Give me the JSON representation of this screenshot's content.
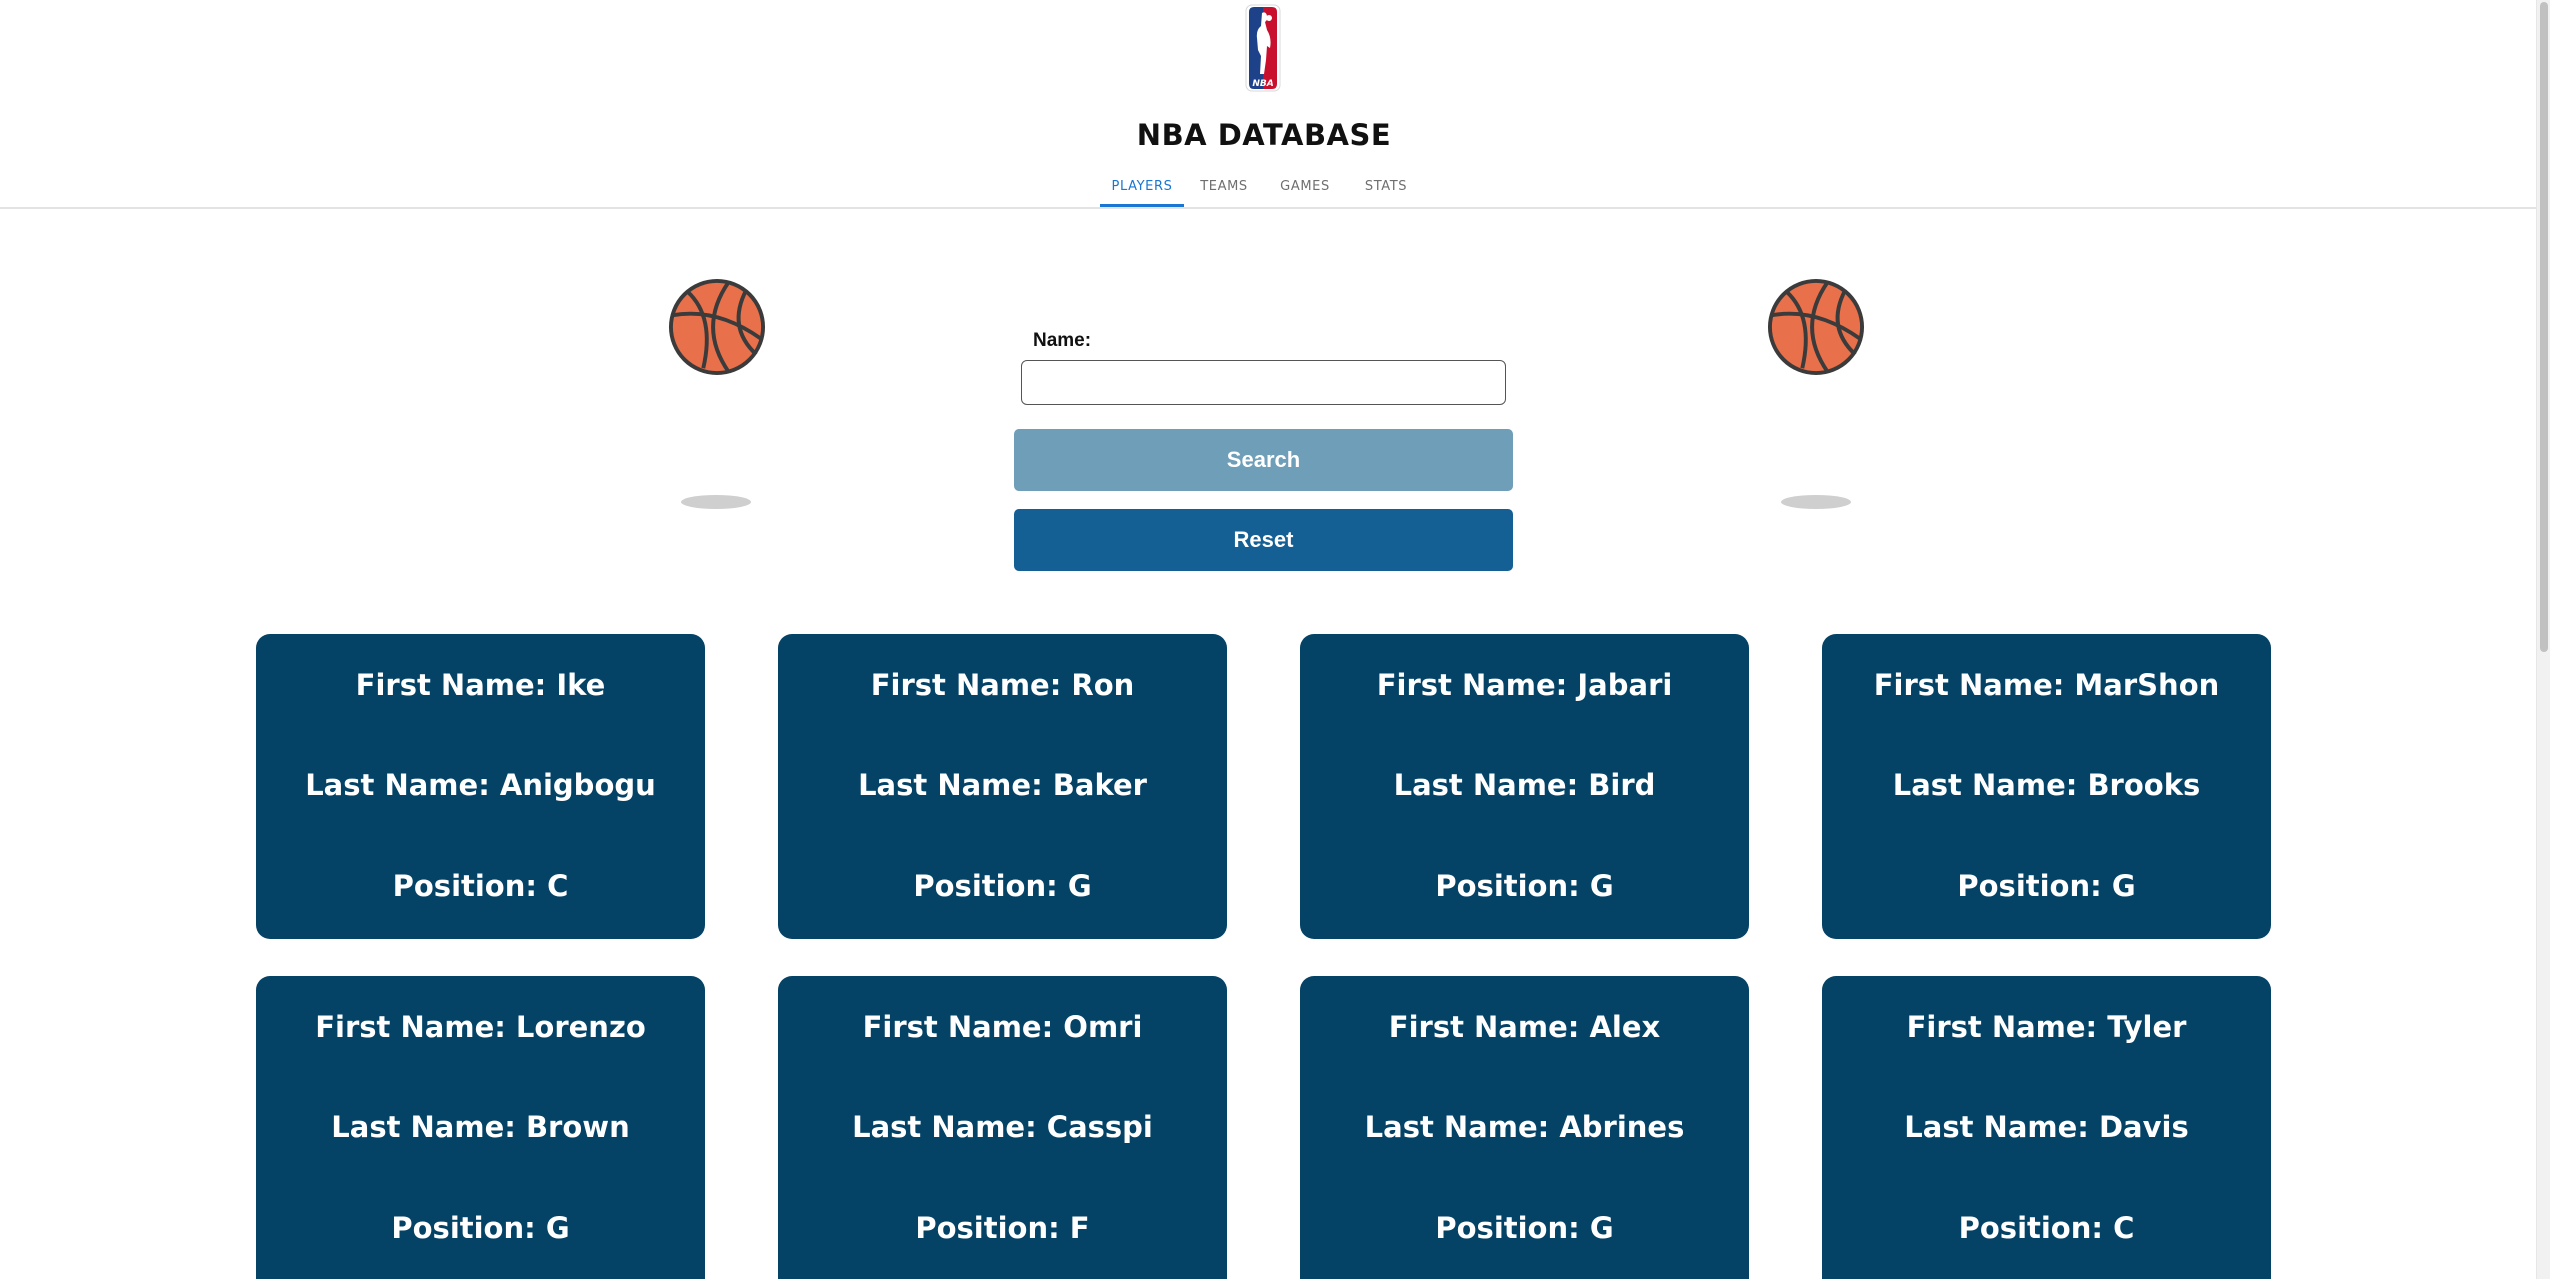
{
  "app": {
    "title": "NBA DATABASE",
    "logo_text": "NBA"
  },
  "tabs": [
    {
      "label": "PLAYERS",
      "active": true
    },
    {
      "label": "TEAMS",
      "active": false
    },
    {
      "label": "GAMES",
      "active": false
    },
    {
      "label": "STATS",
      "active": false
    }
  ],
  "search": {
    "name_label": "Name:",
    "name_value": "",
    "search_button": "Search",
    "reset_button": "Reset"
  },
  "players": [
    {
      "first": "First Name: Ike",
      "last": "Last Name: Anigbogu",
      "position": "Position: C"
    },
    {
      "first": "First Name: Ron",
      "last": "Last Name: Baker",
      "position": "Position: G"
    },
    {
      "first": "First Name: Jabari",
      "last": "Last Name: Bird",
      "position": "Position: G"
    },
    {
      "first": "First Name: MarShon",
      "last": "Last Name: Brooks",
      "position": "Position: G"
    },
    {
      "first": "First Name: Lorenzo",
      "last": "Last Name: Brown",
      "position": "Position: G"
    },
    {
      "first": "First Name: Omri",
      "last": "Last Name: Casspi",
      "position": "Position: F"
    },
    {
      "first": "First Name: Alex",
      "last": "Last Name: Abrines",
      "position": "Position: G"
    },
    {
      "first": "First Name: Tyler",
      "last": "Last Name: Davis",
      "position": "Position: C"
    }
  ],
  "colors": {
    "card": "#044266",
    "search_button": "#6f9eb8",
    "reset_button": "#146094",
    "active_tab": "#1976d2",
    "ball": "#e8704a"
  },
  "icons": [
    "nba-logo",
    "basketball-icon"
  ]
}
